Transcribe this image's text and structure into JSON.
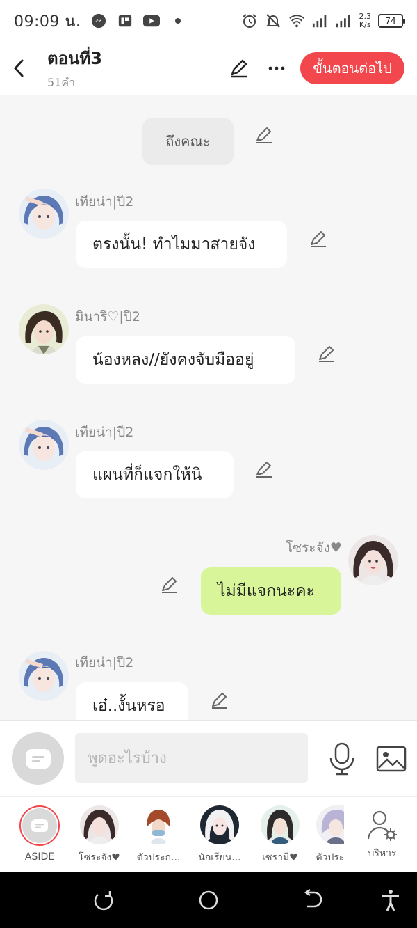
{
  "status": {
    "time": "09:09 น.",
    "speed_value": "2.3",
    "speed_unit": "K/s",
    "battery": "74"
  },
  "header": {
    "title": "ตอนที่3",
    "word_count": "51คำ",
    "next_label": "ขั้นตอนต่อไป"
  },
  "chat": {
    "narration": "ถึงคณะ",
    "messages": [
      {
        "name": "เทียน่า|ปี2",
        "text": "ตรงนั้น! ทำไมมาสายจัง"
      },
      {
        "name": "มินาริ♡|ปี2",
        "text": "น้องหลง//ยังคงจับมืออยู่"
      },
      {
        "name": "เทียน่า|ปี2",
        "text": "แผนที่ก็แจกให้นิ"
      },
      {
        "name": "โซระจัง♥",
        "text": "ไม่มีแจกนะคะ"
      },
      {
        "name": "เทียน่า|ปี2",
        "text": "เอ๋..งั้นหรอ"
      }
    ]
  },
  "input": {
    "placeholder": "พูดอะไรบ้าง"
  },
  "characters": [
    {
      "label": "ASIDE"
    },
    {
      "label": "โซระจัง♥"
    },
    {
      "label": "ตัวประก..."
    },
    {
      "label": "นักเรียน..."
    },
    {
      "label": "เซรามี่♥"
    },
    {
      "label": "ตัวประ"
    },
    {
      "label": "บริหาร"
    }
  ],
  "colors": {
    "accent": "#f2474c",
    "my_bubble": "#d9f59a",
    "background": "#f6f6f6"
  }
}
